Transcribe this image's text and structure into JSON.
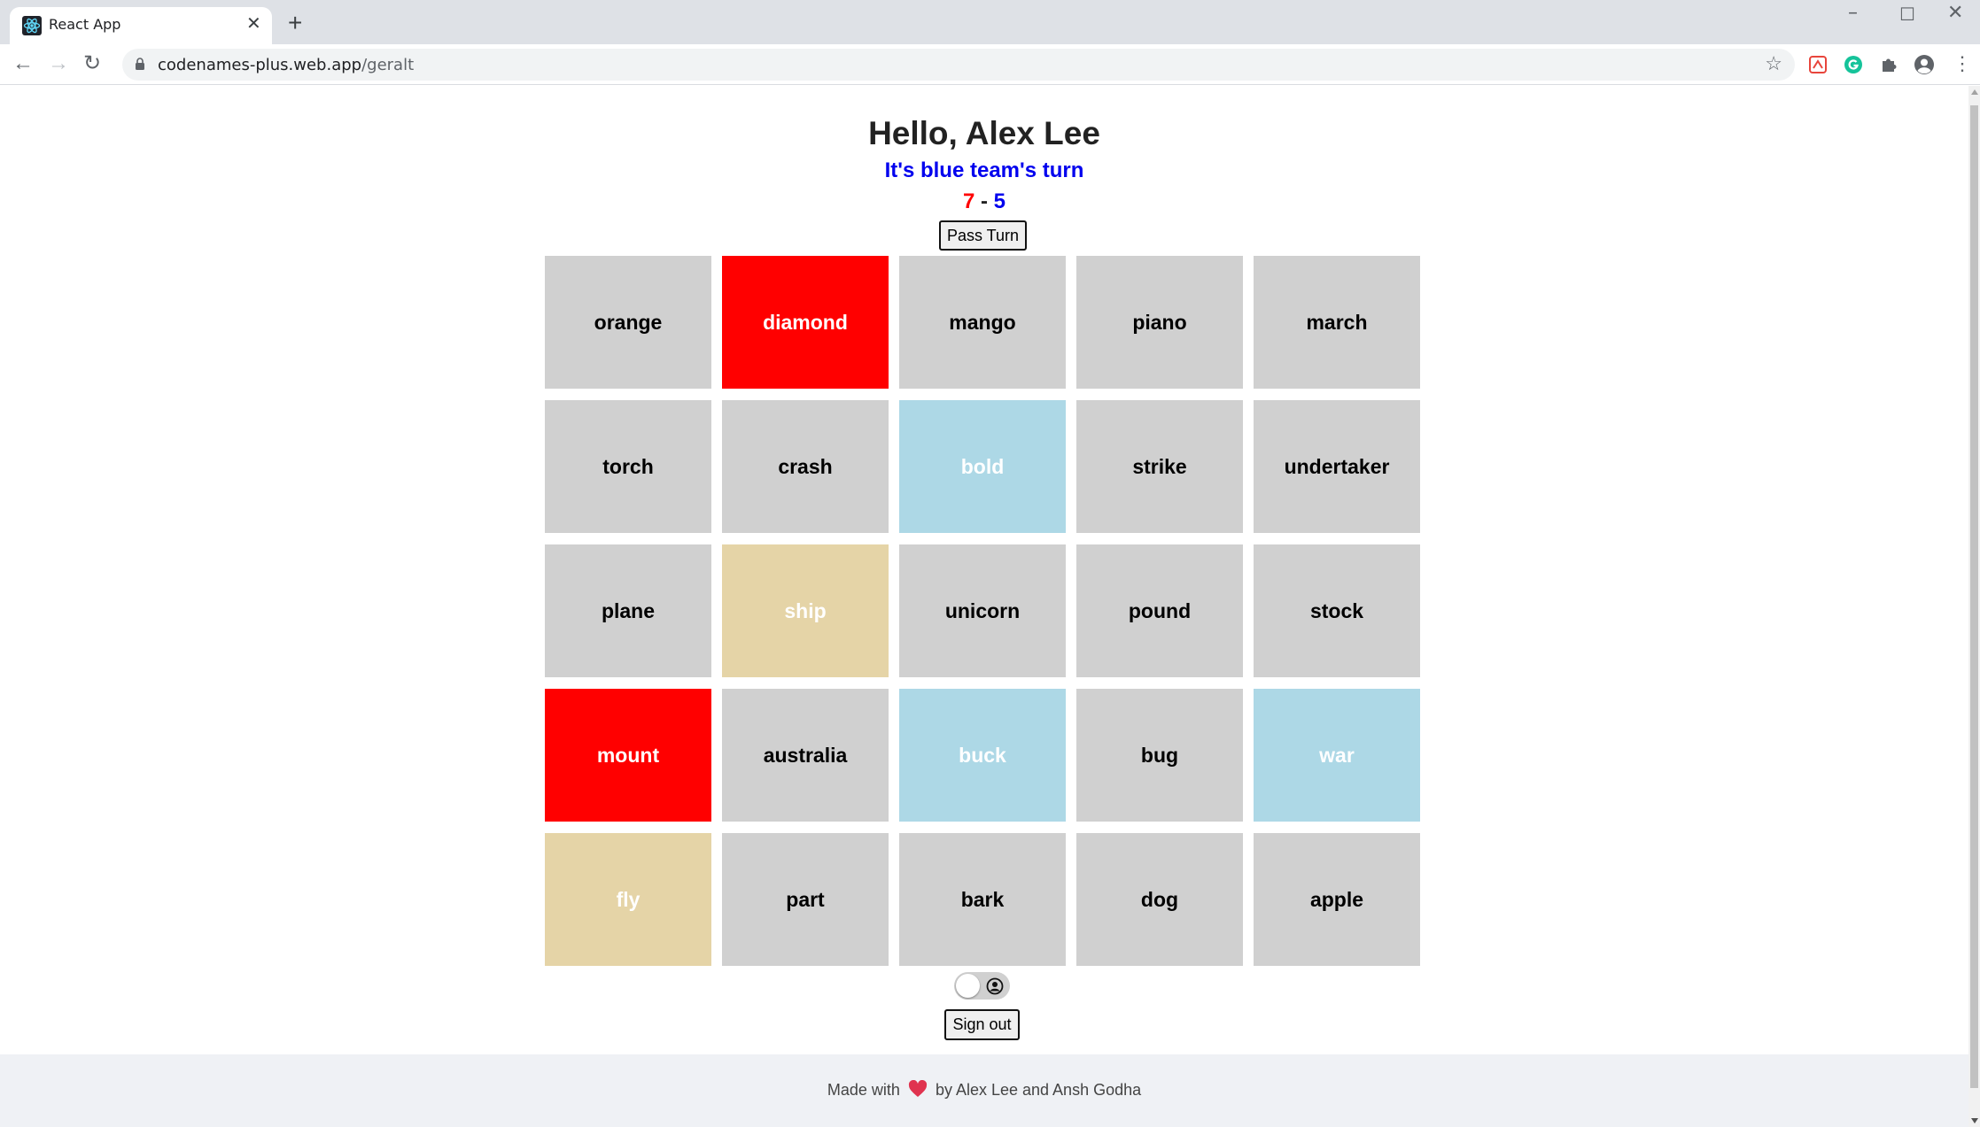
{
  "browser": {
    "tab_title": "React App",
    "url_host": "codenames-plus.web.app",
    "url_path": "/geralt"
  },
  "header": {
    "greeting": "Hello, Alex Lee",
    "turn_text": "It's blue team's turn",
    "score_red": "7",
    "score_separator": " - ",
    "score_blue": "5",
    "pass_turn_label": "Pass Turn"
  },
  "board": {
    "cards": [
      {
        "word": "orange",
        "team": "neutral"
      },
      {
        "word": "diamond",
        "team": "red"
      },
      {
        "word": "mango",
        "team": "neutral"
      },
      {
        "word": "piano",
        "team": "neutral"
      },
      {
        "word": "march",
        "team": "neutral"
      },
      {
        "word": "torch",
        "team": "neutral"
      },
      {
        "word": "crash",
        "team": "neutral"
      },
      {
        "word": "bold",
        "team": "blue"
      },
      {
        "word": "strike",
        "team": "neutral"
      },
      {
        "word": "undertaker",
        "team": "neutral"
      },
      {
        "word": "plane",
        "team": "neutral"
      },
      {
        "word": "ship",
        "team": "tan"
      },
      {
        "word": "unicorn",
        "team": "neutral"
      },
      {
        "word": "pound",
        "team": "neutral"
      },
      {
        "word": "stock",
        "team": "neutral"
      },
      {
        "word": "mount",
        "team": "red"
      },
      {
        "word": "australia",
        "team": "neutral"
      },
      {
        "word": "buck",
        "team": "blue"
      },
      {
        "word": "bug",
        "team": "neutral"
      },
      {
        "word": "war",
        "team": "blue"
      },
      {
        "word": "fly",
        "team": "tan"
      },
      {
        "word": "part",
        "team": "neutral"
      },
      {
        "word": "bark",
        "team": "neutral"
      },
      {
        "word": "dog",
        "team": "neutral"
      },
      {
        "word": "apple",
        "team": "neutral"
      }
    ]
  },
  "controls": {
    "spymaster_toggle_on": false,
    "sign_out_label": "Sign out"
  },
  "footer": {
    "prefix": "Made with",
    "suffix": "by Alex Lee and Ansh Godha"
  },
  "colors": {
    "red": "#ff0000",
    "blue_card": "#add8e6",
    "neutral_card": "#d0d0d0",
    "tan_card": "#e5d4a7",
    "turn_text": "#0000ee"
  },
  "icons": [
    "react-favicon",
    "close-icon",
    "plus-icon",
    "back-icon",
    "forward-icon",
    "reload-icon",
    "lock-icon",
    "star-icon",
    "pdf-extension-icon",
    "grammarly-icon",
    "puzzle-icon",
    "profile-icon",
    "menu-icon",
    "person-icon",
    "heart-icon"
  ]
}
